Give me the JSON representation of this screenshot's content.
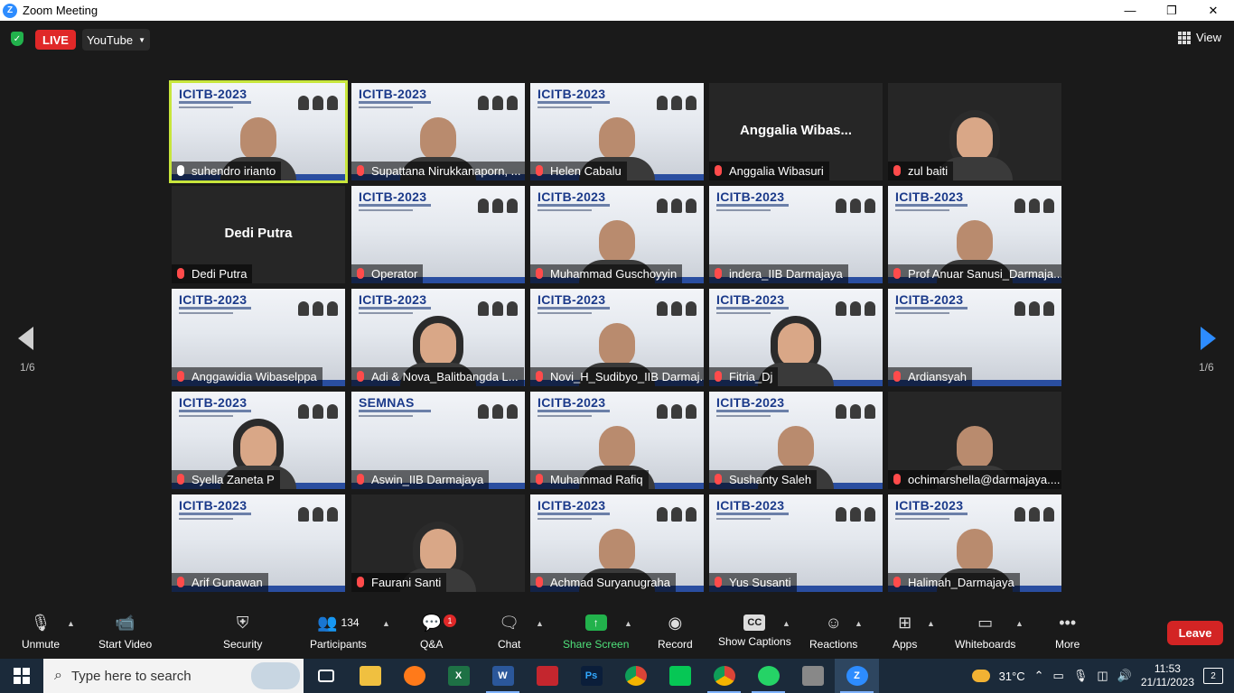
{
  "window": {
    "title": "Zoom Meeting",
    "minimize": "—",
    "maximize": "❐",
    "close": "✕"
  },
  "topbar": {
    "live": "LIVE",
    "stream_target": "YouTube",
    "view": "View"
  },
  "pagination": {
    "left": "1/6",
    "right": "1/6"
  },
  "tiles": [
    {
      "name": "suhendro irianto",
      "poster": true,
      "person": true,
      "muted": false,
      "active": true
    },
    {
      "name": "Supattana Nirukkanaporn, ...",
      "poster": true,
      "person": true,
      "muted": true
    },
    {
      "name": "Helen Cabalu",
      "poster": true,
      "person": true,
      "muted": true
    },
    {
      "name": "Anggalia Wibasuri",
      "big": "Anggalia  Wibas...",
      "poster": false,
      "person": false,
      "muted": true
    },
    {
      "name": "zul baiti",
      "poster": false,
      "person": true,
      "hijab": true,
      "muted": true
    },
    {
      "name": "Dedi Putra",
      "big": "Dedi Putra",
      "poster": false,
      "person": false,
      "muted": true
    },
    {
      "name": "Operator",
      "poster": true,
      "person": false,
      "muted": true
    },
    {
      "name": "Muhammad Guschoyyin",
      "poster": true,
      "person": true,
      "muted": true
    },
    {
      "name": "indera_IIB Darmajaya",
      "poster": true,
      "person": false,
      "muted": true
    },
    {
      "name": "Prof Anuar Sanusi_Darmaja...",
      "poster": true,
      "person": true,
      "muted": true
    },
    {
      "name": "Anggawidia Wibaselppa",
      "poster": true,
      "person": false,
      "muted": true
    },
    {
      "name": "Adi & Nova_Balitbangda L...",
      "poster": true,
      "person": true,
      "hijab": true,
      "muted": true
    },
    {
      "name": "Novi_H_Sudibyo_IIB Darmaj...",
      "poster": true,
      "person": true,
      "muted": true
    },
    {
      "name": "Fitria_Dj",
      "poster": true,
      "person": true,
      "hijab": true,
      "muted": true
    },
    {
      "name": "Ardiansyah",
      "poster": true,
      "person": false,
      "muted": true
    },
    {
      "name": "Syella Zaneta P",
      "poster": true,
      "person": true,
      "hijab": true,
      "muted": true
    },
    {
      "name": "Aswin_IIB Darmajaya",
      "poster": true,
      "logo": "SEMNAS",
      "person": false,
      "muted": true
    },
    {
      "name": "Muhammad Rafiq",
      "poster": true,
      "person": true,
      "muted": true
    },
    {
      "name": "Sushanty Saleh",
      "poster": true,
      "person": true,
      "muted": true
    },
    {
      "name": "ochimarshella@darmajaya....",
      "poster": false,
      "person": true,
      "muted": true
    },
    {
      "name": "Arif Gunawan",
      "poster": true,
      "person": false,
      "muted": true
    },
    {
      "name": "Faurani Santi",
      "poster": false,
      "person": true,
      "hijab": true,
      "muted": true
    },
    {
      "name": "Achmad Suryanugraha",
      "poster": true,
      "person": true,
      "muted": true
    },
    {
      "name": "Yus Susanti",
      "poster": true,
      "person": false,
      "muted": true
    },
    {
      "name": "Halimah_Darmajaya",
      "poster": true,
      "person": true,
      "muted": true
    }
  ],
  "poster_logo": "ICITB-2023",
  "toolbar": {
    "unmute": "Unmute",
    "start_video": "Start Video",
    "security": "Security",
    "participants": "Participants",
    "participants_count": "134",
    "qa": "Q&A",
    "qa_badge": "1",
    "chat": "Chat",
    "share_screen": "Share Screen",
    "record": "Record",
    "show_captions": "Show Captions",
    "reactions": "Reactions",
    "apps": "Apps",
    "whiteboards": "Whiteboards",
    "more": "More",
    "leave": "Leave"
  },
  "taskbar": {
    "search_placeholder": "Type here to search",
    "apps": [
      "task-view",
      "file-explorer",
      "firefox",
      "excel",
      "word",
      "snipping-tool",
      "photoshop",
      "chrome",
      "line",
      "chrome-profile",
      "whatsapp",
      "media-app",
      "zoom"
    ],
    "temperature": "31°C",
    "time": "11:53",
    "date": "21/11/2023",
    "notifications": "2"
  }
}
